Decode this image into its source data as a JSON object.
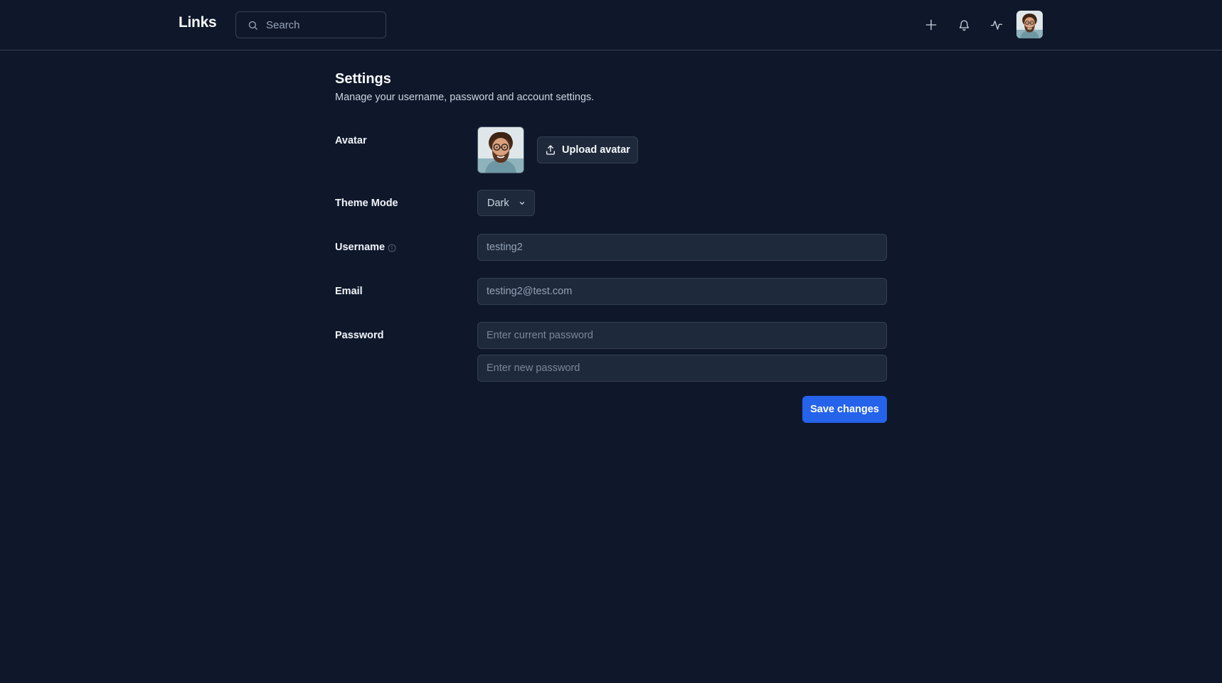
{
  "header": {
    "brand": "Links",
    "search": {
      "placeholder": "Search",
      "value": ""
    },
    "icons": [
      "plus-icon",
      "bell-icon",
      "activity-icon"
    ],
    "avatar": "avatar"
  },
  "page": {
    "title": "Settings",
    "subtitle": "Manage your username, password and account settings."
  },
  "form": {
    "avatar": {
      "label": "Avatar",
      "upload_label": "Upload avatar"
    },
    "theme": {
      "label": "Theme Mode",
      "value": "Dark"
    },
    "username": {
      "label": "Username",
      "value": "testing2"
    },
    "email": {
      "label": "Email",
      "value": "testing2@test.com"
    },
    "password": {
      "label": "Password",
      "current_placeholder": "Enter current password",
      "new_placeholder": "Enter new password"
    },
    "save_label": "Save changes"
  },
  "colors": {
    "background": "#0f172a",
    "input_background": "#1e293b",
    "border": "#334155",
    "primary": "#2563eb",
    "text": "#f1f5f9",
    "muted_text": "#94a3b8"
  }
}
